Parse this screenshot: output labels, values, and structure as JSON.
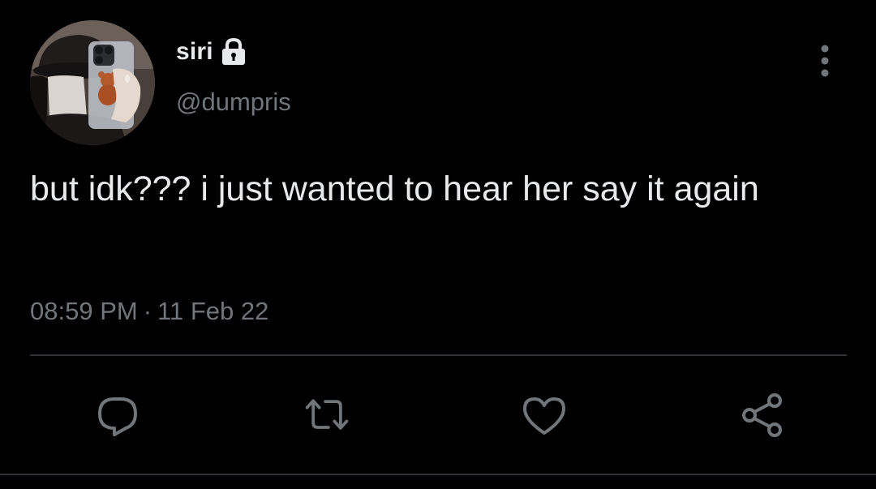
{
  "user": {
    "display_name": "siri",
    "handle": "@dumpris",
    "avatar_icon": "profile-photo",
    "protected_icon": "lock-icon"
  },
  "tweet": {
    "text": "but idk??? i just wanted to hear her say it again",
    "time": "08:59 PM",
    "separator": "·",
    "date": "11 Feb 22"
  },
  "actions": {
    "reply_icon": "reply-icon",
    "retweet_icon": "retweet-icon",
    "like_icon": "heart-icon",
    "share_icon": "share-icon",
    "more_icon": "more-vertical-icon"
  },
  "colors": {
    "background": "#000000",
    "primary_text": "#e7e9ea",
    "secondary_text": "#71767b",
    "divider": "#2f3336"
  }
}
